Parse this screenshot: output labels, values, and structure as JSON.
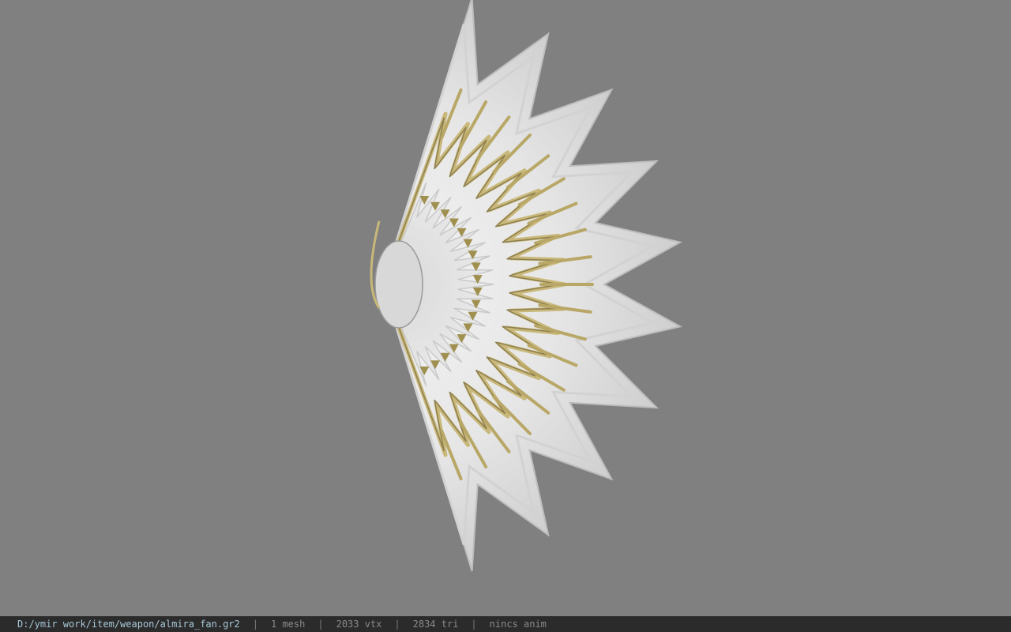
{
  "viewer": {
    "background_color": "#808080",
    "model_label": "almira_fan"
  },
  "status_bar": {
    "file_path": "D:/ymir work/item/weapon/almira_fan.gr2",
    "mesh_count": "1 mesh",
    "vertex_count": "2033 vtx",
    "triangle_count": "2834 tri",
    "animation": "nincs anim",
    "separator": "|"
  }
}
